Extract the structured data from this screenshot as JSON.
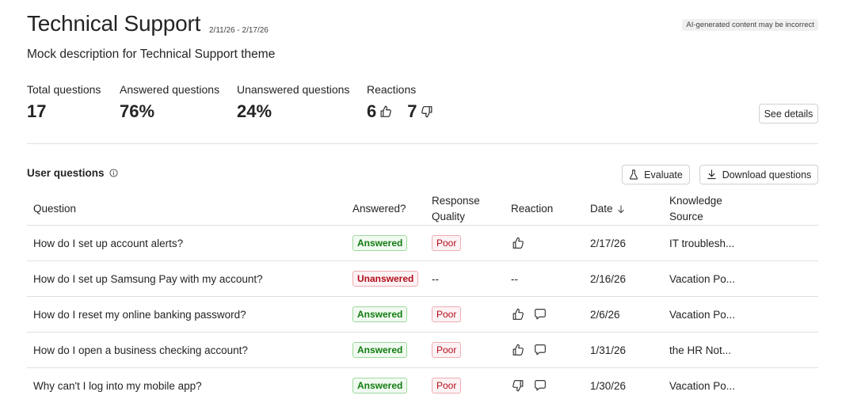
{
  "header": {
    "title": "Technical Support",
    "date_range": "2/11/26 - 2/17/26",
    "ai_notice": "AI-generated content may be incorrect",
    "description": "Mock description for Technical Support theme"
  },
  "stats": {
    "total_label": "Total questions",
    "total_value": "17",
    "answered_label": "Answered questions",
    "answered_value": "76%",
    "unanswered_label": "Unanswered questions",
    "unanswered_value": "24%",
    "reactions_label": "Reactions",
    "thumbs_up": "6",
    "thumbs_down": "7",
    "see_details": "See details"
  },
  "user_questions": {
    "title": "User questions",
    "evaluate": "Evaluate",
    "download": "Download questions",
    "columns": {
      "question": "Question",
      "answered": "Answered?",
      "quality_1": "Response",
      "quality_2": "Quality",
      "reaction": "Reaction",
      "date": "Date",
      "source_1": "Knowledge",
      "source_2": "Source"
    },
    "rows": [
      {
        "question": "How do I set up account alerts?",
        "answered": "Answered",
        "quality": "Poor",
        "reaction": [
          "thumbs-up"
        ],
        "reaction_text": "",
        "date": "2/17/26",
        "source": "IT troublesh..."
      },
      {
        "question": "How do I set up Samsung Pay with my account?",
        "answered": "Unanswered",
        "quality": "--",
        "reaction": [],
        "reaction_text": "--",
        "date": "2/16/26",
        "source": "Vacation Po..."
      },
      {
        "question": "How do I reset my online banking password?",
        "answered": "Answered",
        "quality": "Poor",
        "reaction": [
          "thumbs-up",
          "comment"
        ],
        "reaction_text": "",
        "date": "2/6/26",
        "source": "Vacation Po..."
      },
      {
        "question": "How do I open a business checking account?",
        "answered": "Answered",
        "quality": "Poor",
        "reaction": [
          "thumbs-up",
          "comment"
        ],
        "reaction_text": "",
        "date": "1/31/26",
        "source": "the HR Not..."
      },
      {
        "question": "Why can't I log into my mobile app?",
        "answered": "Answered",
        "quality": "Poor",
        "reaction": [
          "thumbs-down",
          "comment"
        ],
        "reaction_text": "",
        "date": "1/30/26",
        "source": "Vacation Po..."
      }
    ]
  }
}
